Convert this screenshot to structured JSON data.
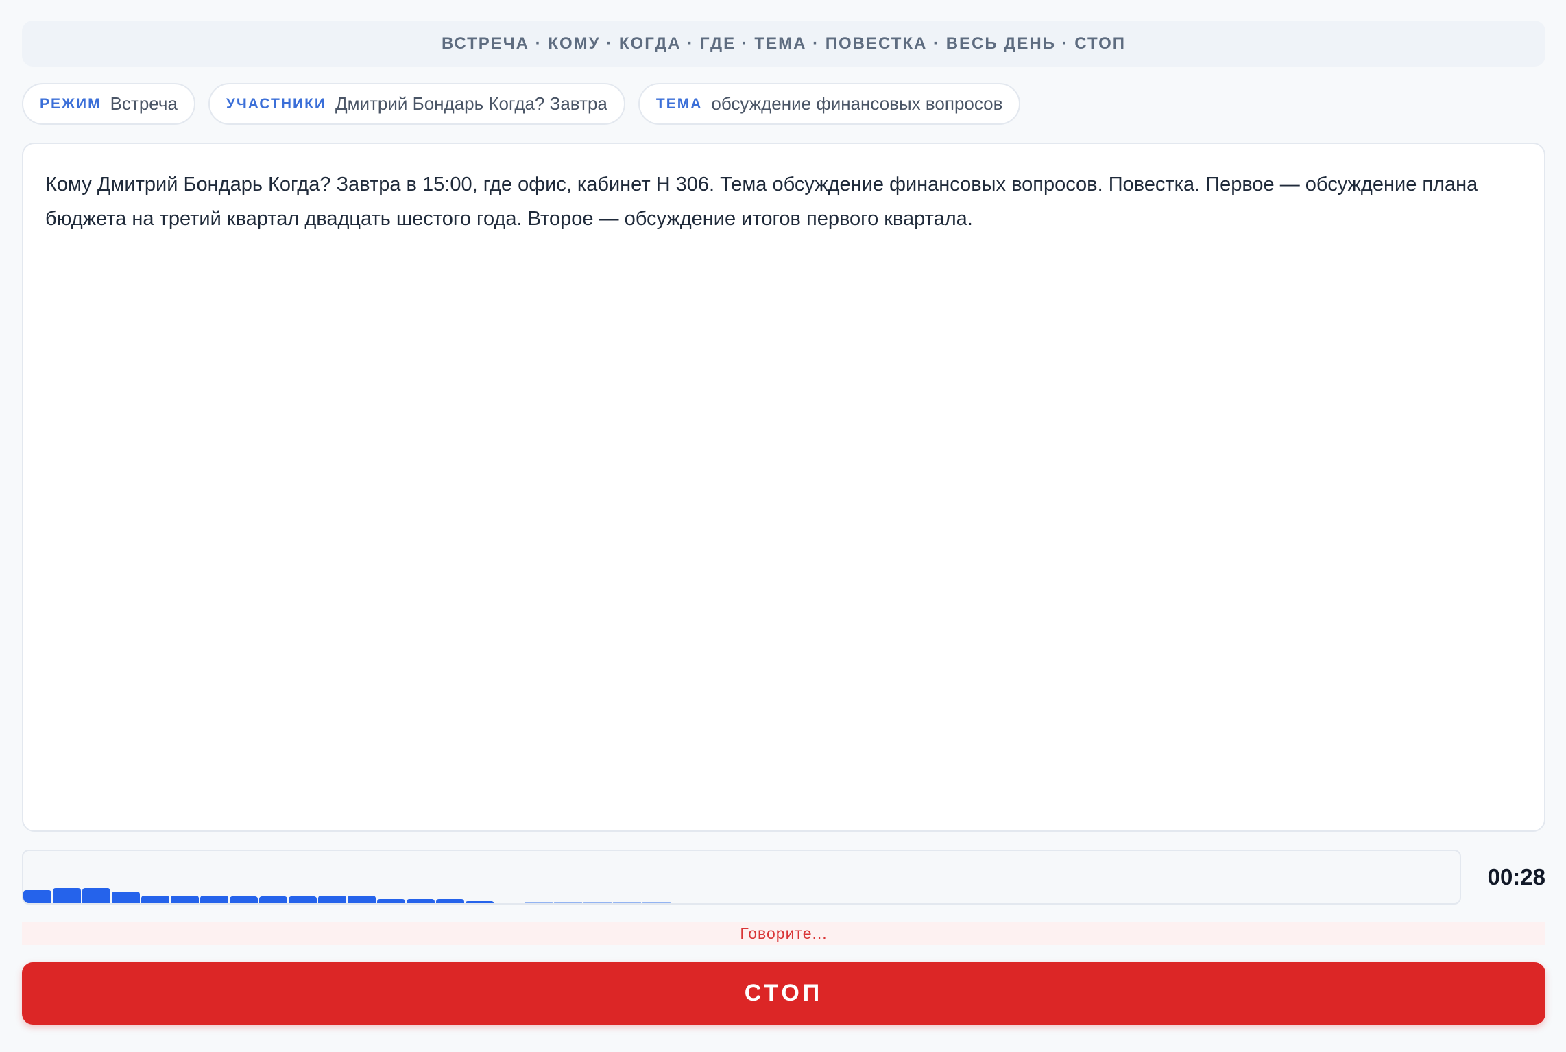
{
  "hint_bar": {
    "text": "ВСТРЕЧА · КОМУ · КОГДА · ГДЕ · ТЕМА · ПОВЕСТКА · ВЕСЬ ДЕНЬ · СТОП"
  },
  "chips": [
    {
      "key": "РЕЖИМ",
      "value": "Встреча"
    },
    {
      "key": "УЧАСТНИКИ",
      "value": "Дмитрий Бондарь Когда? Завтра"
    },
    {
      "key": "ТЕМА",
      "value": "обсуждение финансовых вопросов"
    }
  ],
  "transcript": {
    "text": "Кому Дмитрий Бондарь Когда? Завтра в 15:00, где офис, кабинет Н 306. Тема обсуждение финансовых вопросов. Повестка. Первое — обсуждение плана бюджета на третий квартал двадцать шестого года. Второе — обсуждение итогов первого квартала."
  },
  "audio_meter": {
    "levels": [
      0.24,
      0.28,
      0.27,
      0.21,
      0.14,
      0.14,
      0.14,
      0.13,
      0.13,
      0.12,
      0.14,
      0.14,
      0.07,
      0.07,
      0.07,
      0.04,
      0,
      0.03,
      0.03,
      0.02,
      0.02,
      0.01
    ],
    "active_color": "#2563eb",
    "faded_color": "#93b4f2"
  },
  "timer": {
    "value": "00:28"
  },
  "status": {
    "text": "Говорите..."
  },
  "stop_button": {
    "label": "СТОП",
    "color": "#dc2626"
  }
}
